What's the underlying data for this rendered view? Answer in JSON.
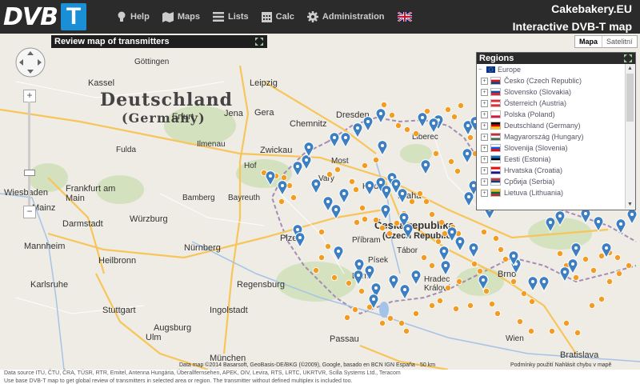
{
  "app": {
    "logo_text": "DVB",
    "logo_badge": "T",
    "brand_site": "Cakebakery.EU",
    "brand_title": "Interactive DVB-T map"
  },
  "nav": [
    {
      "label": "Help",
      "icon": "lightbulb-icon"
    },
    {
      "label": "Maps",
      "icon": "map-icon"
    },
    {
      "label": "Lists",
      "icon": "list-icon"
    },
    {
      "label": "Calc",
      "icon": "calendar-icon"
    },
    {
      "label": "Administration",
      "icon": "gear-icon"
    }
  ],
  "review_panel": {
    "title": "Review map of transmitters"
  },
  "map_type": {
    "active": "Mapa",
    "inactive": "Satelitní"
  },
  "regions": {
    "title": "Regions",
    "root": "Europe",
    "items": [
      {
        "label": "Česko (Czech Republic)",
        "flag": [
          "#ffffff",
          "#d7141a",
          "#11457e"
        ]
      },
      {
        "label": "Slovensko (Slovakia)",
        "flag": [
          "#ffffff",
          "#0b4ea2",
          "#ee1c25"
        ]
      },
      {
        "label": "Österreich (Austria)",
        "flag": [
          "#ed2939",
          "#ffffff",
          "#ed2939"
        ]
      },
      {
        "label": "Polska (Poland)",
        "flag": [
          "#ffffff",
          "#ffffff",
          "#dc143c"
        ]
      },
      {
        "label": "Deutschland (Germany)",
        "flag": [
          "#000000",
          "#dd0000",
          "#ffce00"
        ]
      },
      {
        "label": "Magyarország (Hungary)",
        "flag": [
          "#ce2939",
          "#ffffff",
          "#477050"
        ]
      },
      {
        "label": "Slovenija (Slovenia)",
        "flag": [
          "#ffffff",
          "#005ce5",
          "#ff0000"
        ]
      },
      {
        "label": "Eesti (Estonia)",
        "flag": [
          "#0072ce",
          "#000000",
          "#ffffff"
        ]
      },
      {
        "label": "Hrvatska (Croatia)",
        "flag": [
          "#ff0000",
          "#ffffff",
          "#171796"
        ]
      },
      {
        "label": "Србија (Serbia)",
        "flag": [
          "#c6363c",
          "#0c4076",
          "#ffffff"
        ]
      },
      {
        "label": "Lietuva (Lithuania)",
        "flag": [
          "#fdb913",
          "#006a44",
          "#c1272d"
        ]
      }
    ]
  },
  "map_labels": [
    {
      "text": "Deutschland",
      "cls": "country"
    },
    {
      "text": "(Germany)",
      "cls": "country"
    },
    {
      "text": "Česká republika",
      "cls": "country2"
    },
    {
      "text": "(Czech Republic)",
      "cls": "country2"
    },
    {
      "text": "Leipzig"
    },
    {
      "text": "Chemnitz"
    },
    {
      "text": "Dresden"
    },
    {
      "text": "Zwickau"
    },
    {
      "text": "Jena"
    },
    {
      "text": "Gera"
    },
    {
      "text": "Erfurt"
    },
    {
      "text": "Ilmenau"
    },
    {
      "text": "Frankfurt am Main"
    },
    {
      "text": "Wiesbaden"
    },
    {
      "text": "Mainz"
    },
    {
      "text": "Darmstadt"
    },
    {
      "text": "Würzburg"
    },
    {
      "text": "Nürnberg"
    },
    {
      "text": "Regensburg"
    },
    {
      "text": "Mannheim"
    },
    {
      "text": "Heilbronn"
    },
    {
      "text": "Karlsruhe"
    },
    {
      "text": "Stuttgart"
    },
    {
      "text": "Ulm"
    },
    {
      "text": "Ingolstadt"
    },
    {
      "text": "Augsburg"
    },
    {
      "text": "München"
    },
    {
      "text": "Passau"
    },
    {
      "text": "Plzeň"
    },
    {
      "text": "Kladno"
    },
    {
      "text": "Praha"
    },
    {
      "text": "Příbram"
    },
    {
      "text": "Písek"
    },
    {
      "text": "Tábor"
    },
    {
      "text": "Brno"
    },
    {
      "text": "Bratislava"
    },
    {
      "text": "Hradec Králové"
    },
    {
      "text": "Liberec"
    },
    {
      "text": "Kassel"
    },
    {
      "text": "Göttingen"
    },
    {
      "text": "Bayreuth"
    },
    {
      "text": "Bamberg"
    },
    {
      "text": "Fulda"
    },
    {
      "text": "Hof"
    },
    {
      "text": "Vary"
    },
    {
      "text": "Most"
    },
    {
      "text": "Bern."
    },
    {
      "text": "Wien"
    }
  ],
  "attribution": {
    "map_data": "Data map ©2014 Basarsoft, GeoBasis-DE/BKG (©2009), Google, basado en BCN IGN España · 50 km",
    "terms": "Podmínky použití   Nahlásit chybu v mapě"
  },
  "footer": {
    "line1": "Data source ITU, ČTU, ČRA, TÚSR, RTR, Emitel, Antenna Hungária, Überallfernsehen, APEK, OIV, Levira, RTS, LRTC, UKRTVR, Scilla Systems Ltd., Teracom",
    "line2": "Use base DVB-T map to get global review of transmitters in selected area or region. The transmitter without defined multiplex is included too."
  },
  "colors": {
    "topbar": "#2b2b2b",
    "accent": "#1a8fd6",
    "pin_blue": "#3d7fc1",
    "pin_orange": "#f39c1f"
  }
}
